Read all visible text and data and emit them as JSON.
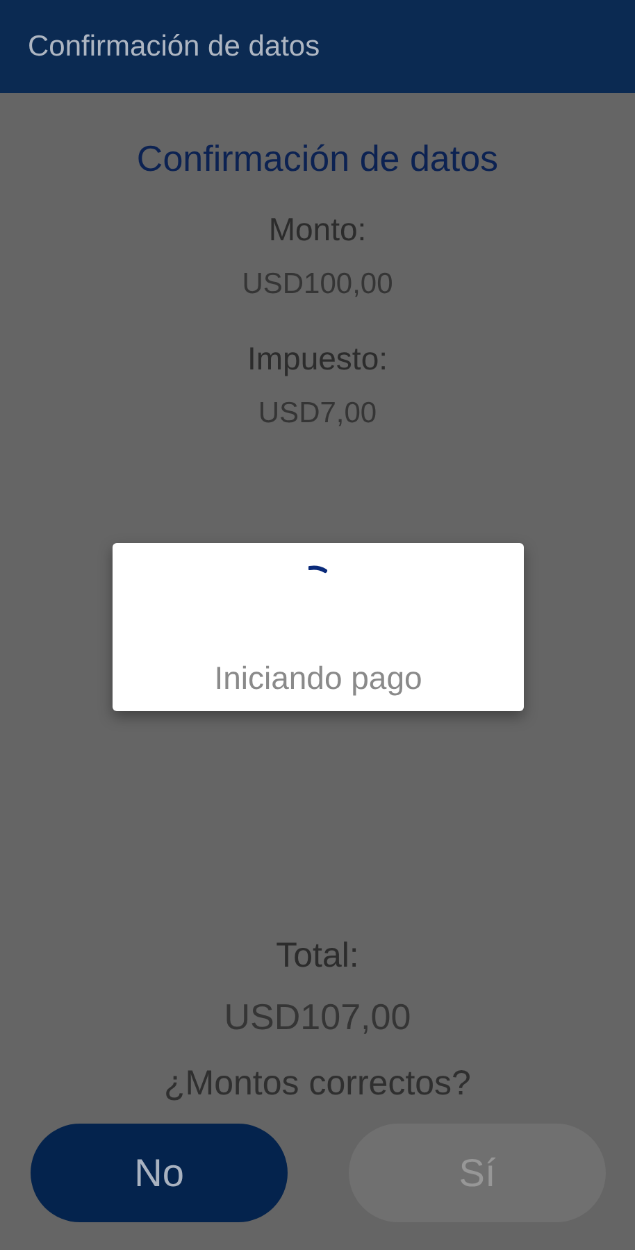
{
  "app_bar": {
    "title": "Confirmación de datos"
  },
  "heading": "Confirmación de datos",
  "fields": [
    {
      "label": "Monto:",
      "value": "USD100,00"
    },
    {
      "label": "Impuesto:",
      "value": "USD7,00"
    }
  ],
  "total": {
    "label": "Total:",
    "value": "USD107,00"
  },
  "question": "¿Montos correctos?",
  "buttons": [
    {
      "label": "No",
      "disabled": false
    },
    {
      "label": "Sí",
      "disabled": true
    }
  ],
  "loading_dialog": {
    "message": "Iniciando pago"
  }
}
